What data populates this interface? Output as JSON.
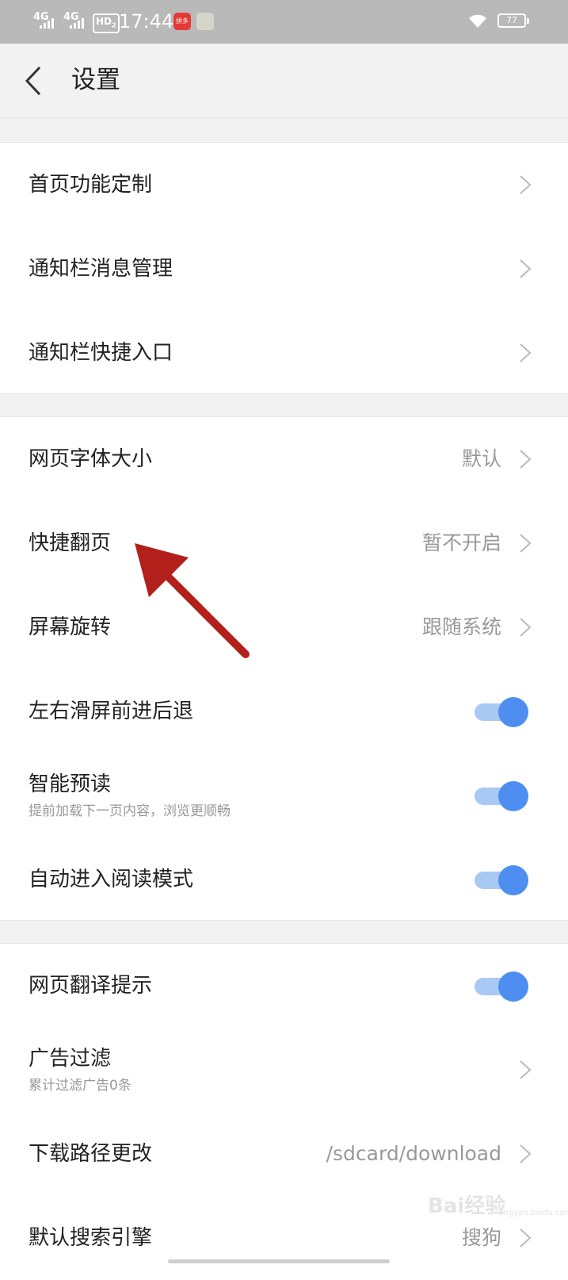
{
  "status_bar": {
    "signal1": "4G",
    "signal2": "4G",
    "hd": "HD",
    "hd_sub": "2",
    "time": "17:44",
    "app1_label": "拼多",
    "battery": "77"
  },
  "header": {
    "back_icon": "chevron-left-icon",
    "title": "设置"
  },
  "section1": [
    {
      "label": "首页功能定制"
    },
    {
      "label": "通知栏消息管理"
    },
    {
      "label": "通知栏快捷入口"
    }
  ],
  "section2": [
    {
      "label": "网页字体大小",
      "value": "默认"
    },
    {
      "label": "快捷翻页",
      "value": "暂不开启"
    },
    {
      "label": "屏幕旋转",
      "value": "跟随系统"
    },
    {
      "label": "左右滑屏前进后退",
      "toggle": true
    },
    {
      "label": "智能预读",
      "sub": "提前加载下一页内容，浏览更顺畅",
      "toggle": true
    },
    {
      "label": "自动进入阅读模式",
      "toggle": true
    }
  ],
  "section3": [
    {
      "label": "网页翻译提示",
      "toggle": true
    },
    {
      "label": "广告过滤",
      "sub": "累计过滤广告0条"
    },
    {
      "label": "下载路径更改",
      "value": "/sdcard/download"
    },
    {
      "label": "默认搜索引擎",
      "value": "搜狗"
    }
  ],
  "colors": {
    "accent": "#4d8ef0",
    "arrow": "#b3201b"
  },
  "watermark": {
    "text": "Bai经验",
    "sub": "jingyan.baidu.com"
  }
}
